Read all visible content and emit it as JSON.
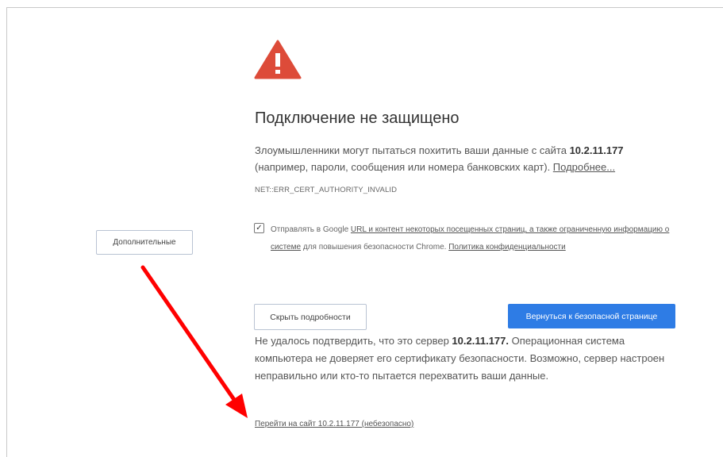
{
  "page": {
    "title": "Подключение не защищено",
    "desc_prefix": "Злоумышленники могут пытаться похитить ваши данные с сайта ",
    "desc_host": "10.2.11.177",
    "desc_suffix": " (например, пароли, сообщения или номера банковских карт). ",
    "desc_more_link": "Подробнее...",
    "error_code": "NET::ERR_CERT_AUTHORITY_INVALID"
  },
  "report": {
    "checked": true,
    "check_mark": "✓",
    "prefix": "Отправлять в Google ",
    "link_urls": "URL и контент некоторых посещенных страниц, а также ограниченную информацию о системе",
    "middle": " для повышения безопасности Chrome. ",
    "link_policy": "Политика конфиденциальности"
  },
  "buttons": {
    "advanced": "Дополнительные",
    "hide_details": "Скрыть подробности",
    "back_to_safety": "Вернуться к безопасной странице"
  },
  "details": {
    "prefix": "Не удалось подтвердить, что это сервер ",
    "host": "10.2.11.177.",
    "suffix": " Операционная система компьютера не доверяет его сертификату безопасности. Возможно, сервер настроен неправильно или кто-то пытается перехватить ваши данные.",
    "proceed_link": "Перейти на сайт 10.2.11.177 (небезопасно)"
  },
  "colors": {
    "warning_red": "#dd4b39",
    "primary_button": "#2e7ce5",
    "annotation_arrow": "#ff0000"
  },
  "icons": {
    "warning": "warning-triangle-icon",
    "arrow": "annotation-arrow"
  }
}
